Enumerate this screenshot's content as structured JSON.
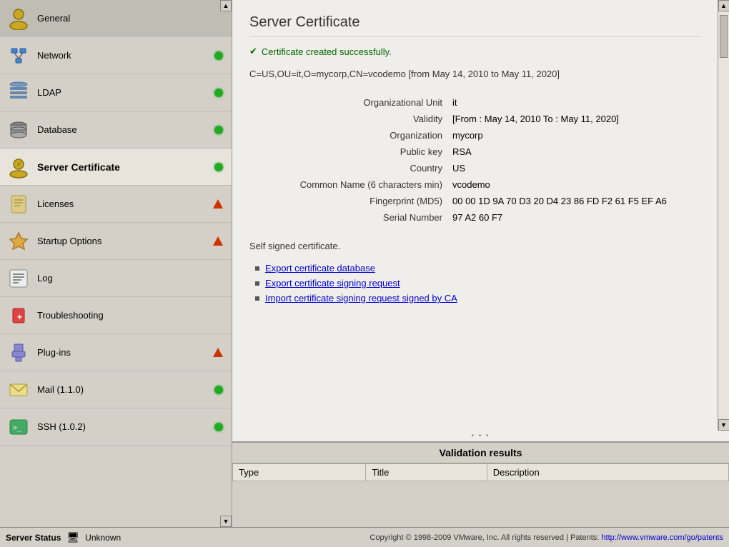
{
  "sidebar": {
    "items": [
      {
        "id": "general",
        "label": "General",
        "status": "none",
        "active": false
      },
      {
        "id": "network",
        "label": "Network",
        "status": "green",
        "active": false
      },
      {
        "id": "ldap",
        "label": "LDAP",
        "status": "green",
        "active": false
      },
      {
        "id": "database",
        "label": "Database",
        "status": "green",
        "active": false
      },
      {
        "id": "server-certificate",
        "label": "Server Certificate",
        "status": "green",
        "active": true
      },
      {
        "id": "licenses",
        "label": "Licenses",
        "status": "triangle",
        "active": false
      },
      {
        "id": "startup-options",
        "label": "Startup Options",
        "status": "triangle",
        "active": false
      },
      {
        "id": "log",
        "label": "Log",
        "status": "none",
        "active": false
      },
      {
        "id": "troubleshooting",
        "label": "Troubleshooting",
        "status": "none",
        "active": false
      },
      {
        "id": "plug-ins",
        "label": "Plug-ins",
        "status": "triangle",
        "active": false
      },
      {
        "id": "mail",
        "label": "Mail (1.1.0)",
        "status": "green",
        "active": false
      },
      {
        "id": "ssh",
        "label": "SSH (1.0.2)",
        "status": "green",
        "active": false
      }
    ]
  },
  "content": {
    "page_title": "Server Certificate",
    "success_message": "Certificate created successfully.",
    "cert_info_line": "C=US,OU=it,O=mycorp,CN=vcodemo [from May 14, 2010 to May 11, 2020]",
    "fields": [
      {
        "label": "Organizational Unit",
        "value": "it"
      },
      {
        "label": "Validity",
        "value": "[From : May 14, 2010 To : May 11, 2020]"
      },
      {
        "label": "Organization",
        "value": "mycorp"
      },
      {
        "label": "Public key",
        "value": "RSA"
      },
      {
        "label": "Country",
        "value": "US"
      },
      {
        "label": "Common Name (6 characters min)",
        "value": "vcodemo"
      },
      {
        "label": "Fingerprint (MD5)",
        "value": "00 00 1D 9A 70 D3 20 D4 23 86 FD F2 61 F5 EF A6"
      },
      {
        "label": "Serial Number",
        "value": "97 A2 60 F7"
      }
    ],
    "self_signed_text": "Self signed certificate.",
    "links": [
      {
        "id": "export-db",
        "text": "Export certificate database"
      },
      {
        "id": "export-csr",
        "text": "Export certificate signing request"
      },
      {
        "id": "import-csr",
        "text": "Import certificate signing request signed by CA"
      }
    ]
  },
  "validation": {
    "title": "Validation results",
    "columns": [
      "Type",
      "Title",
      "Description"
    ]
  },
  "status_bar": {
    "label": "Server Status",
    "status_text": "Unknown",
    "copyright": "Copyright © 1998-2009 VMware, Inc. All rights reserved | Patents: ",
    "patent_link_text": "http://www.vmware.com/go/patents",
    "patent_link_url": "http://www.vmware.com/go/patents"
  }
}
